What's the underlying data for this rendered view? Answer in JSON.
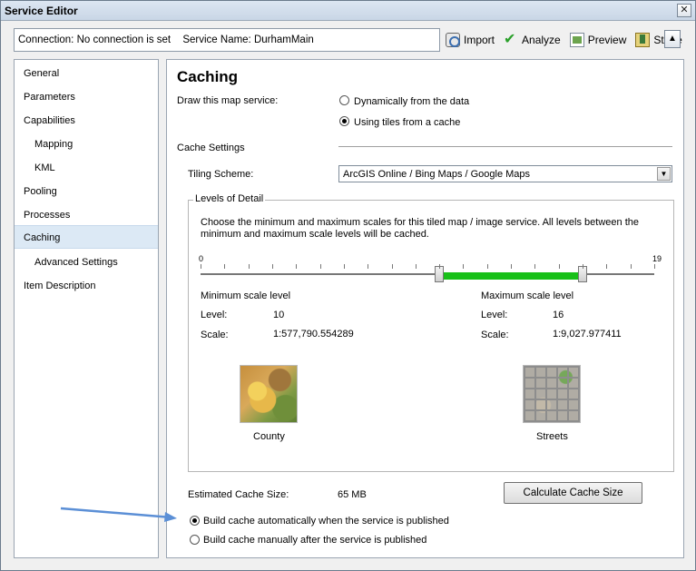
{
  "window": {
    "title": "Service Editor",
    "close_glyph": "✕"
  },
  "connection_bar": {
    "connection": "Connection: No connection is set",
    "service_name": "Service Name: DurhamMain"
  },
  "toolbar": {
    "import_label": "Import",
    "analyze_label": "Analyze",
    "preview_label": "Preview",
    "stage_label": "Stage",
    "collapse_glyph": "▲"
  },
  "sidebar": {
    "items": [
      {
        "label": "General"
      },
      {
        "label": "Parameters"
      },
      {
        "label": "Capabilities"
      },
      {
        "label": "Mapping"
      },
      {
        "label": "KML"
      },
      {
        "label": "Pooling"
      },
      {
        "label": "Processes"
      },
      {
        "label": "Caching"
      },
      {
        "label": "Advanced Settings"
      },
      {
        "label": "Item Description"
      }
    ],
    "selected": "Caching"
  },
  "caching": {
    "heading": "Caching",
    "draw_label": "Draw this map service:",
    "draw_option_dynamic": "Dynamically from the data",
    "draw_option_tiles": "Using tiles from a cache",
    "draw_selected": "Using tiles from a cache",
    "cache_settings_label": "Cache Settings",
    "tiling_scheme_label": "Tiling Scheme:",
    "tiling_scheme_value": "ArcGIS Online / Bing Maps / Google Maps",
    "lod": {
      "title": "Levels of Detail",
      "description": "Choose the minimum and maximum scales for this tiled map / image service. All levels between the minimum and maximum scale levels will be cached.",
      "slider_min_label": "0",
      "slider_max_label": "19",
      "slider_range_min": 0,
      "slider_range_max": 19,
      "min_heading": "Minimum scale level",
      "max_heading": "Maximum scale level",
      "level_label": "Level:",
      "scale_label": "Scale:",
      "min_level": "10",
      "min_scale": "1:577,790.554289",
      "max_level": "16",
      "max_scale": "1:9,027.977411",
      "min_caption": "County",
      "max_caption": "Streets",
      "fill_color": "#18c018"
    },
    "estimated_label": "Estimated Cache Size:",
    "estimated_value": "65 MB",
    "calc_button": "Calculate Cache Size",
    "build_auto": "Build cache automatically when the service is published",
    "build_manual": "Build cache manually after the service is published",
    "build_selected": "Build cache automatically when the service is published"
  }
}
